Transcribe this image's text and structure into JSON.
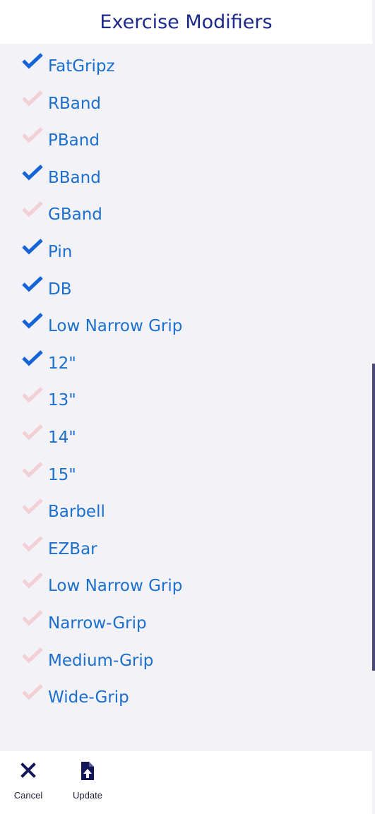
{
  "header": {
    "title": "Exercise Modifiers"
  },
  "modifiers": [
    {
      "label": "FatGripz",
      "checked": true
    },
    {
      "label": "RBand",
      "checked": false
    },
    {
      "label": "PBand",
      "checked": false
    },
    {
      "label": "BBand",
      "checked": true
    },
    {
      "label": "GBand",
      "checked": false
    },
    {
      "label": "Pin",
      "checked": true
    },
    {
      "label": "DB",
      "checked": true
    },
    {
      "label": "Low Narrow Grip",
      "checked": true
    },
    {
      "label": "12\"",
      "checked": true
    },
    {
      "label": "13\"",
      "checked": false
    },
    {
      "label": "14\"",
      "checked": false
    },
    {
      "label": "15\"",
      "checked": false
    },
    {
      "label": "Barbell",
      "checked": false
    },
    {
      "label": "EZBar",
      "checked": false
    },
    {
      "label": "Low Narrow Grip",
      "checked": false
    },
    {
      "label": "Narrow-Grip",
      "checked": false
    },
    {
      "label": "Medium-Grip",
      "checked": false
    },
    {
      "label": "Wide-Grip",
      "checked": false
    }
  ],
  "footer": {
    "cancel_label": "Cancel",
    "cancel_icon": "close-icon",
    "update_label": "Update",
    "update_icon": "file-upload-icon"
  },
  "colors": {
    "title": "#1c2a8c",
    "label": "#1a6fcf",
    "check_on": "#1565d8",
    "check_off": "#f3cfd6",
    "list_background": "#f2f2f7",
    "footer_icon": "#14165a"
  }
}
